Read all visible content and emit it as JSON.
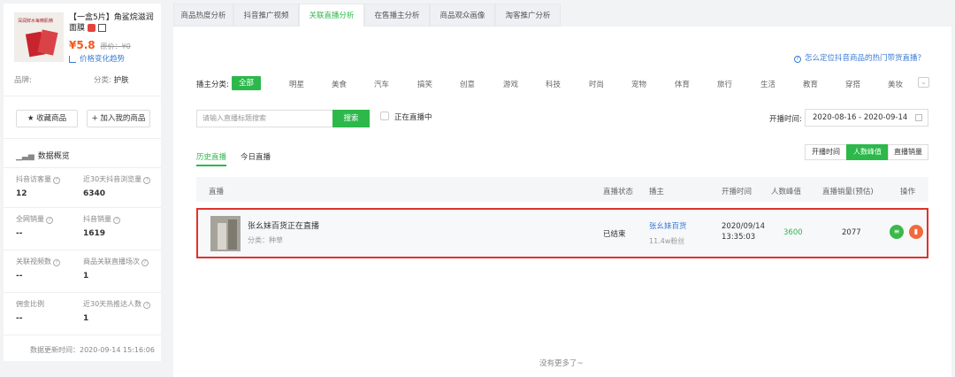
{
  "product": {
    "image_text": "深润鲜水每精肌精",
    "title": "【一盒5片】角鲨烷滋润面膜",
    "price": "¥5.8",
    "original_price": "原价：¥0",
    "trend_link": "价格变化趋势",
    "brand_label": "品牌:",
    "category_label": "分类:",
    "category_value": "护肤"
  },
  "sidebar_buttons": {
    "favorite": "★ 收藏商品",
    "add_mine": "+ 加入我的商品"
  },
  "stats": {
    "title": "数据概览",
    "items": [
      {
        "label": "抖音访客量",
        "value": "12"
      },
      {
        "label": "近30天抖音浏览量",
        "value": "6340"
      },
      {
        "label": "全网销量",
        "value": "--"
      },
      {
        "label": "抖音销量",
        "value": "1619"
      },
      {
        "label": "关联视频数",
        "value": "--"
      },
      {
        "label": "商品关联直播场次",
        "value": "1"
      },
      {
        "label": "佣金比例",
        "value": "--"
      },
      {
        "label": "近30天热推达人数",
        "value": "1"
      }
    ],
    "updated": "数据更新时间：2020-09-14 15:16:06"
  },
  "tabs": [
    "商品热度分析",
    "抖音推广视频",
    "关联直播分析",
    "在售播主分析",
    "商品观众画像",
    "淘客推广分析"
  ],
  "help_link": "怎么定位抖音商品的热门带货直播？",
  "category_filter": {
    "label": "播主分类:",
    "items": [
      "全部",
      "明星",
      "美食",
      "汽车",
      "搞笑",
      "创意",
      "游戏",
      "科技",
      "时尚",
      "宠物",
      "体育",
      "旅行",
      "生活",
      "教育",
      "穿搭",
      "美妆"
    ]
  },
  "search": {
    "placeholder": "请输入直播标题搜索",
    "button": "搜索",
    "live_now": "正在直播中"
  },
  "date": {
    "label": "开播时间:",
    "range": "2020-08-16 - 2020-09-14"
  },
  "sub_tabs": [
    "历史直播",
    "今日直播"
  ],
  "sort_buttons": [
    "开播时间",
    "人数峰值",
    "直播销量"
  ],
  "table": {
    "headers": [
      "直播",
      "直播状态",
      "播主",
      "开播时间",
      "人数峰值",
      "直播销量(预估)",
      "操作"
    ],
    "rows": [
      {
        "title": "张幺妹百货正在直播",
        "category": "分类：种草",
        "status": "已结束",
        "host": "张幺妹百货",
        "fans": "11.4w粉丝",
        "date": "2020/09/14",
        "time": "13:35:03",
        "peak": "3600",
        "sales": "2077"
      }
    ]
  },
  "footer": "没有更多了~",
  "colors": {
    "accent": "#2db84b",
    "price": "#f5561b",
    "link": "#3a7bd5",
    "highlight_border": "#e0322c"
  }
}
